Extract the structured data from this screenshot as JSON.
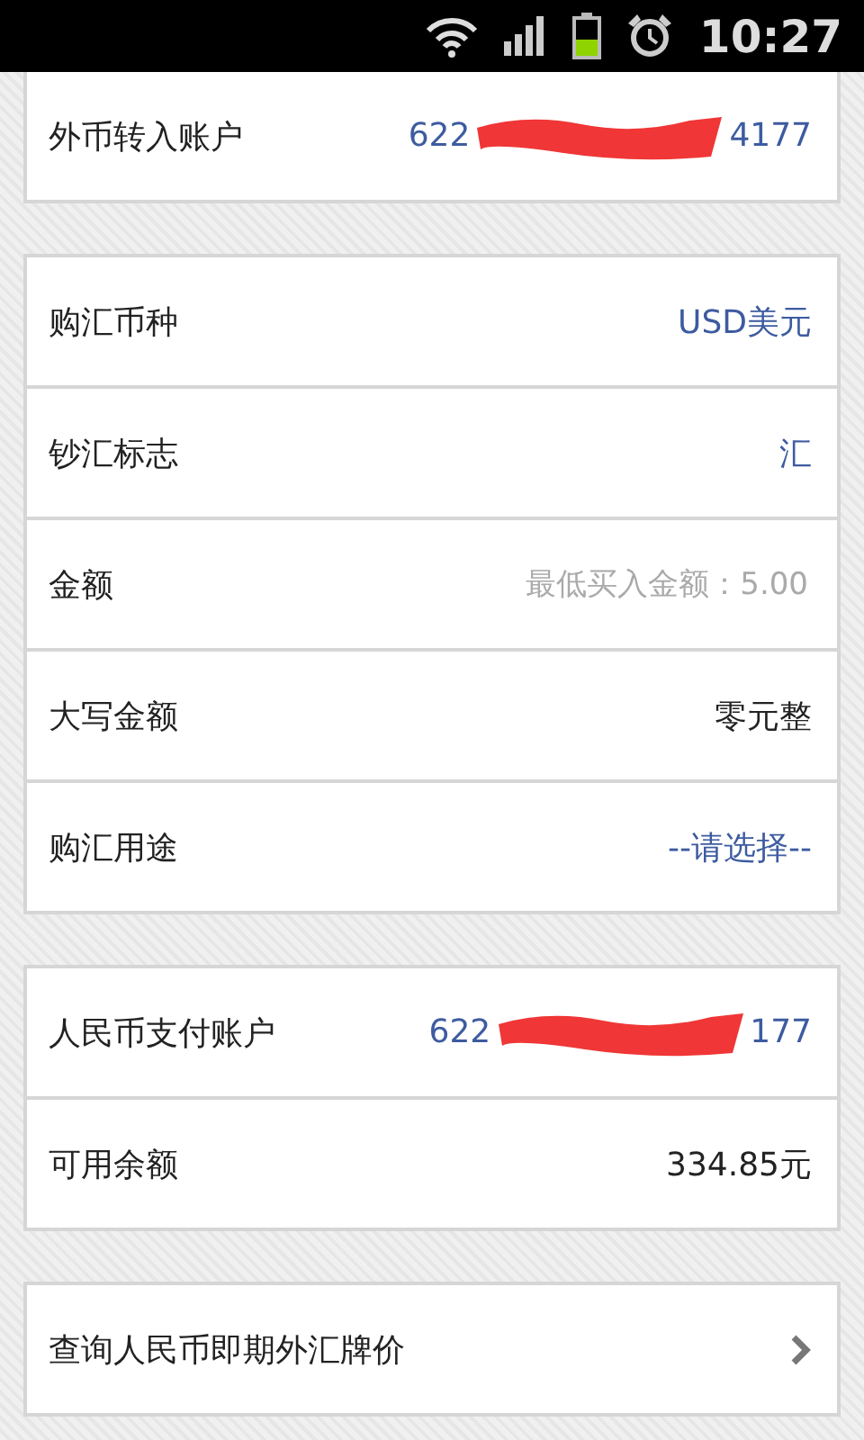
{
  "status_bar": {
    "time": "10:27"
  },
  "sections": [
    {
      "rows": [
        {
          "label": "外币转入账户",
          "kind": "account",
          "prefix": "622",
          "suffix": "4177"
        }
      ]
    },
    {
      "rows": [
        {
          "label": "购汇币种",
          "kind": "select",
          "value": "USD美元"
        },
        {
          "label": "钞汇标志",
          "kind": "select",
          "value": "汇"
        },
        {
          "label": "金额",
          "kind": "input",
          "placeholder": "最低买入金额：5.00"
        },
        {
          "label": "大写金额",
          "kind": "text",
          "value": "零元整"
        },
        {
          "label": "购汇用途",
          "kind": "select",
          "value": "--请选择--"
        }
      ]
    },
    {
      "rows": [
        {
          "label": "人民币支付账户",
          "kind": "account",
          "prefix": "622",
          "suffix": "177"
        },
        {
          "label": "可用余额",
          "kind": "text",
          "value": "334.85元"
        }
      ]
    },
    {
      "rows": [
        {
          "label": "查询人民币即期外汇牌价",
          "kind": "link"
        }
      ]
    }
  ]
}
